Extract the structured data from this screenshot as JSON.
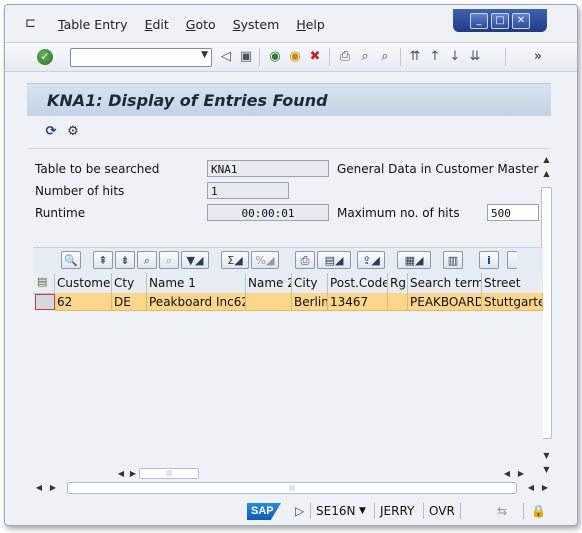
{
  "window": {
    "controls": [
      "_",
      "□",
      "✕"
    ]
  },
  "menubar": {
    "items": [
      "Table Entry",
      "Edit",
      "Goto",
      "System",
      "Help"
    ],
    "underline": [
      "T",
      "E",
      "G",
      "S",
      "H"
    ]
  },
  "title": "KNA1: Display of Entries Found",
  "fields": {
    "table_label": "Table to be searched",
    "table_value": "KNA1",
    "table_desc": "General Data in Customer Master",
    "hits_label": "Number of hits",
    "hits_value": "1",
    "runtime_label": "Runtime",
    "runtime_value": "00:00:01",
    "max_label": "Maximum no. of hits",
    "max_value": "500"
  },
  "grid": {
    "columns": [
      "Customer",
      "Cty",
      "Name 1",
      "Name 2",
      "City",
      "Post.Code",
      "Rg",
      "Search term",
      "Street"
    ],
    "rows": [
      [
        "62",
        "DE",
        "Peakboard Inc62",
        "",
        "Berlin",
        "13467",
        "",
        "PEAKBOARD",
        "Stuttgarter"
      ]
    ]
  },
  "status": {
    "logo": "SAP",
    "transaction": "SE16N",
    "user": "JERRY",
    "mode": "OVR"
  },
  "icons": {
    "menu": "window-menu-icon",
    "check": "enter-check-icon",
    "refresh": "refresh-icon",
    "settings": "technical-settings-icon"
  }
}
